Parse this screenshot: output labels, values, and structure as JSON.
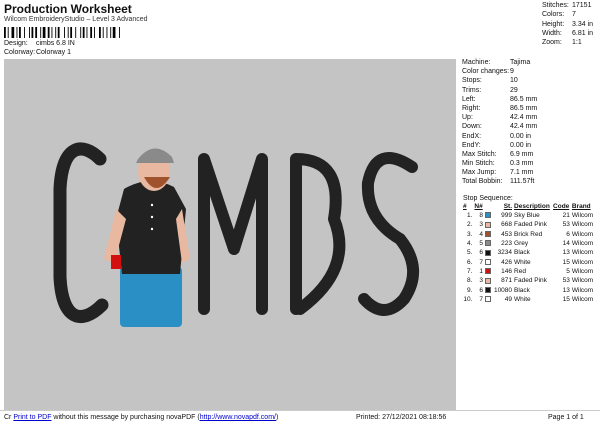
{
  "header": {
    "title": "Production Worksheet",
    "subtitle": "Wilcom EmbroideryStudio – Level 3 Advanced",
    "design_label": "Design:",
    "design_value": "cimbs 6.8 IN",
    "colorway_label": "Colorway:",
    "colorway_value": "Colorway 1"
  },
  "stats": [
    {
      "label": "Stitches:",
      "value": "17151"
    },
    {
      "label": "Colors:",
      "value": "7"
    },
    {
      "label": "Height:",
      "value": "3.34 in"
    },
    {
      "label": "Width:",
      "value": "6.81 in"
    },
    {
      "label": "Zoom:",
      "value": "1:1"
    }
  ],
  "design_art": {
    "letters": "MBS",
    "letter_color": "#222222",
    "background": "#c4c4c4"
  },
  "machine_info": [
    {
      "label": "Machine:",
      "value": "Tajima"
    },
    {
      "label": "Color changes:",
      "value": "9"
    },
    {
      "label": "Stops:",
      "value": "10"
    },
    {
      "label": "Trims:",
      "value": "29"
    },
    {
      "label": "Left:",
      "value": "86.5 mm"
    },
    {
      "label": "Right:",
      "value": "86.5 mm"
    },
    {
      "label": "Up:",
      "value": "42.4 mm"
    },
    {
      "label": "Down:",
      "value": "42.4 mm"
    },
    {
      "label": "EndX:",
      "value": "0.00 in"
    },
    {
      "label": "EndY:",
      "value": "0.00 in"
    },
    {
      "label": "Max Stitch:",
      "value": "6.9 mm"
    },
    {
      "label": "Min Stitch:",
      "value": "0.3 mm"
    },
    {
      "label": "Max Jump:",
      "value": "7.1 mm"
    },
    {
      "label": "Total Bobbin:",
      "value": "111.57ft"
    }
  ],
  "stop_sequence": {
    "label": "Stop Sequence:",
    "headers": [
      "#",
      "N#",
      "",
      "St.",
      "Description",
      "Code",
      "Brand"
    ],
    "rows": [
      {
        "n": "1.",
        "needle": "8",
        "color": "#2a8fc4",
        "st": "999",
        "desc": "Sky Blue",
        "code": "21",
        "brand": "Wilcom"
      },
      {
        "n": "2.",
        "needle": "3",
        "color": "#e8b8a0",
        "st": "668",
        "desc": "Faded Pink",
        "code": "53",
        "brand": "Wilcom"
      },
      {
        "n": "3.",
        "needle": "4",
        "color": "#a0522d",
        "st": "453",
        "desc": "Brick Red",
        "code": "6",
        "brand": "Wilcom"
      },
      {
        "n": "4.",
        "needle": "5",
        "color": "#8a8a8a",
        "st": "223",
        "desc": "Grey",
        "code": "14",
        "brand": "Wilcom"
      },
      {
        "n": "5.",
        "needle": "6",
        "color": "#111111",
        "st": "3234",
        "desc": "Black",
        "code": "13",
        "brand": "Wilcom"
      },
      {
        "n": "6.",
        "needle": "7",
        "color": "#ffffff",
        "st": "426",
        "desc": "White",
        "code": "15",
        "brand": "Wilcom"
      },
      {
        "n": "7.",
        "needle": "1",
        "color": "#d21010",
        "st": "146",
        "desc": "Red",
        "code": "5",
        "brand": "Wilcom"
      },
      {
        "n": "8.",
        "needle": "3",
        "color": "#e8b8a0",
        "st": "871",
        "desc": "Faded Pink",
        "code": "53",
        "brand": "Wilcom"
      },
      {
        "n": "9.",
        "needle": "6",
        "color": "#111111",
        "st": "10080",
        "desc": "Black",
        "code": "13",
        "brand": "Wilcom"
      },
      {
        "n": "10.",
        "needle": "7",
        "color": "#ffffff",
        "st": "49",
        "desc": "White",
        "code": "15",
        "brand": "Wilcom"
      }
    ]
  },
  "footer": {
    "prefix": "Cr",
    "link_text": "Print to PDF",
    "middle_text": " without this message by purchasing novaPDF (",
    "url_text": "http://www.novapdf.com/",
    "suffix": ")",
    "printed": "Printed: 27/12/2021 08:18:56",
    "page": "Page 1 of 1"
  }
}
